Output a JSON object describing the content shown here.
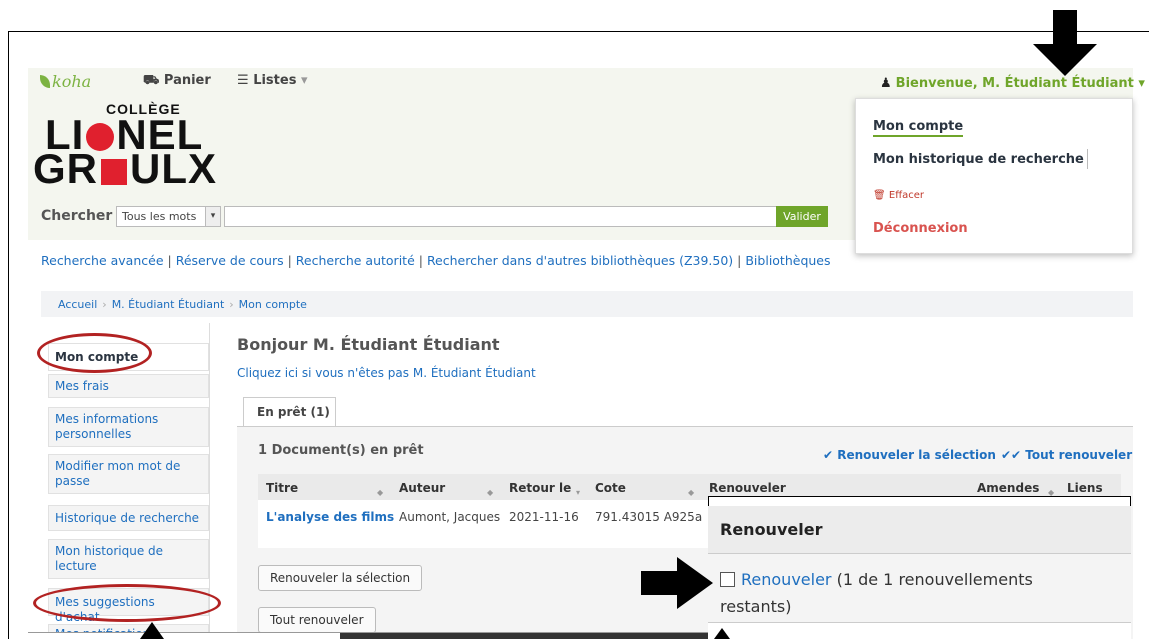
{
  "topbar": {
    "logo_text": "koha",
    "cart_label": "Panier",
    "cart_icon": "cart-icon",
    "lists_label": "Listes",
    "lists_icon": "list-icon",
    "welcome_text": "Bienvenue, M. Étudiant Étudiant",
    "welcome_caret": "▾"
  },
  "logo": {
    "college": "COLLÈGE",
    "line1_a": "LI",
    "line1_b": "NEL",
    "line2_a": "GR",
    "line2_b": "ULX"
  },
  "search": {
    "label": "Chercher",
    "index_value": "Tous les mots",
    "query_value": "",
    "submit_label": "Valider"
  },
  "more_searches": [
    "Recherche avancée",
    "Réserve de cours",
    "Recherche autorité",
    "Rechercher dans d'autres bibliothèques (Z39.50)",
    "Bibliothèques"
  ],
  "user_menu": {
    "account": "Mon compte",
    "search_history": "Mon historique de recherche",
    "clear": "Effacer",
    "logout": "Déconnexion"
  },
  "breadcrumb": [
    "Accueil",
    "M. Étudiant Étudiant",
    "Mon compte"
  ],
  "sidebar": {
    "items": [
      "Mon compte",
      "Mes frais",
      "Mes informations personnelles",
      "Modifier mon mot de passe",
      "Historique de recherche",
      "Mon historique de lecture",
      "Mes suggestions d'achat",
      "Mes notifications"
    ]
  },
  "main": {
    "greeting": "Bonjour M. Étudiant Étudiant",
    "not_you": "Cliquez ici si vous n'êtes pas M. Étudiant Étudiant",
    "tab_label": "En prêt (1)",
    "checkouts_title": "1 Document(s) en prêt",
    "renew_selected_link": "Renouveler la sélection",
    "renew_all_link": "Tout renouveler",
    "columns": [
      "Titre",
      "Auteur",
      "Retour le",
      "Cote",
      "Renouveler",
      "Amendes",
      "Liens"
    ],
    "rows": [
      {
        "title": "L'analyse des films",
        "author": "Aumont, Jacques",
        "due": "2021-11-16",
        "callnumber": "791.43015 A925a"
      }
    ],
    "renew_selected_button": "Renouveler la sélection",
    "renew_all_button": "Tout renouveler"
  },
  "renew_popup": {
    "heading": "Renouveler",
    "link": "Renouveler",
    "remaining_line1": " (1 de 1 renouvellements",
    "remaining_line2": "restants)"
  },
  "colors": {
    "accent_green": "#6fa52a",
    "link_blue": "#1f6fbf",
    "annotation_red": "#b22222"
  }
}
